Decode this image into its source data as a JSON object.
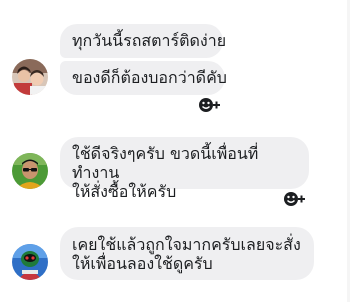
{
  "conversation": {
    "messages": [
      {
        "sender": "user-1",
        "bubbles": [
          {
            "text": "ทุกวันนี้รถสตาร์ติดง่าย"
          },
          {
            "text": "ของดีก็ต้องบอกว่าดีคับ"
          }
        ],
        "reaction_icon": "add-reaction-icon"
      },
      {
        "sender": "user-2",
        "bubbles": [
          {
            "lines": [
              "ใช้ดีจริงๆครับ ขวดนี้เพื่อนที่ทำงาน",
              "ให้สั่งซื้อให้ครับ"
            ]
          }
        ],
        "reaction_icon": "add-reaction-icon"
      },
      {
        "sender": "user-3",
        "bubbles": [
          {
            "lines": [
              "เคยใช้แล้วถูกใจมากครับเลยจะสั่ง",
              "ให้เพื่อนลองใช้ดูครับ"
            ]
          }
        ]
      }
    ]
  },
  "colors": {
    "bubble_bg": "#efeff1",
    "text": "#1c1e21",
    "icon": "#1c1e21",
    "background": "#ffffff"
  }
}
